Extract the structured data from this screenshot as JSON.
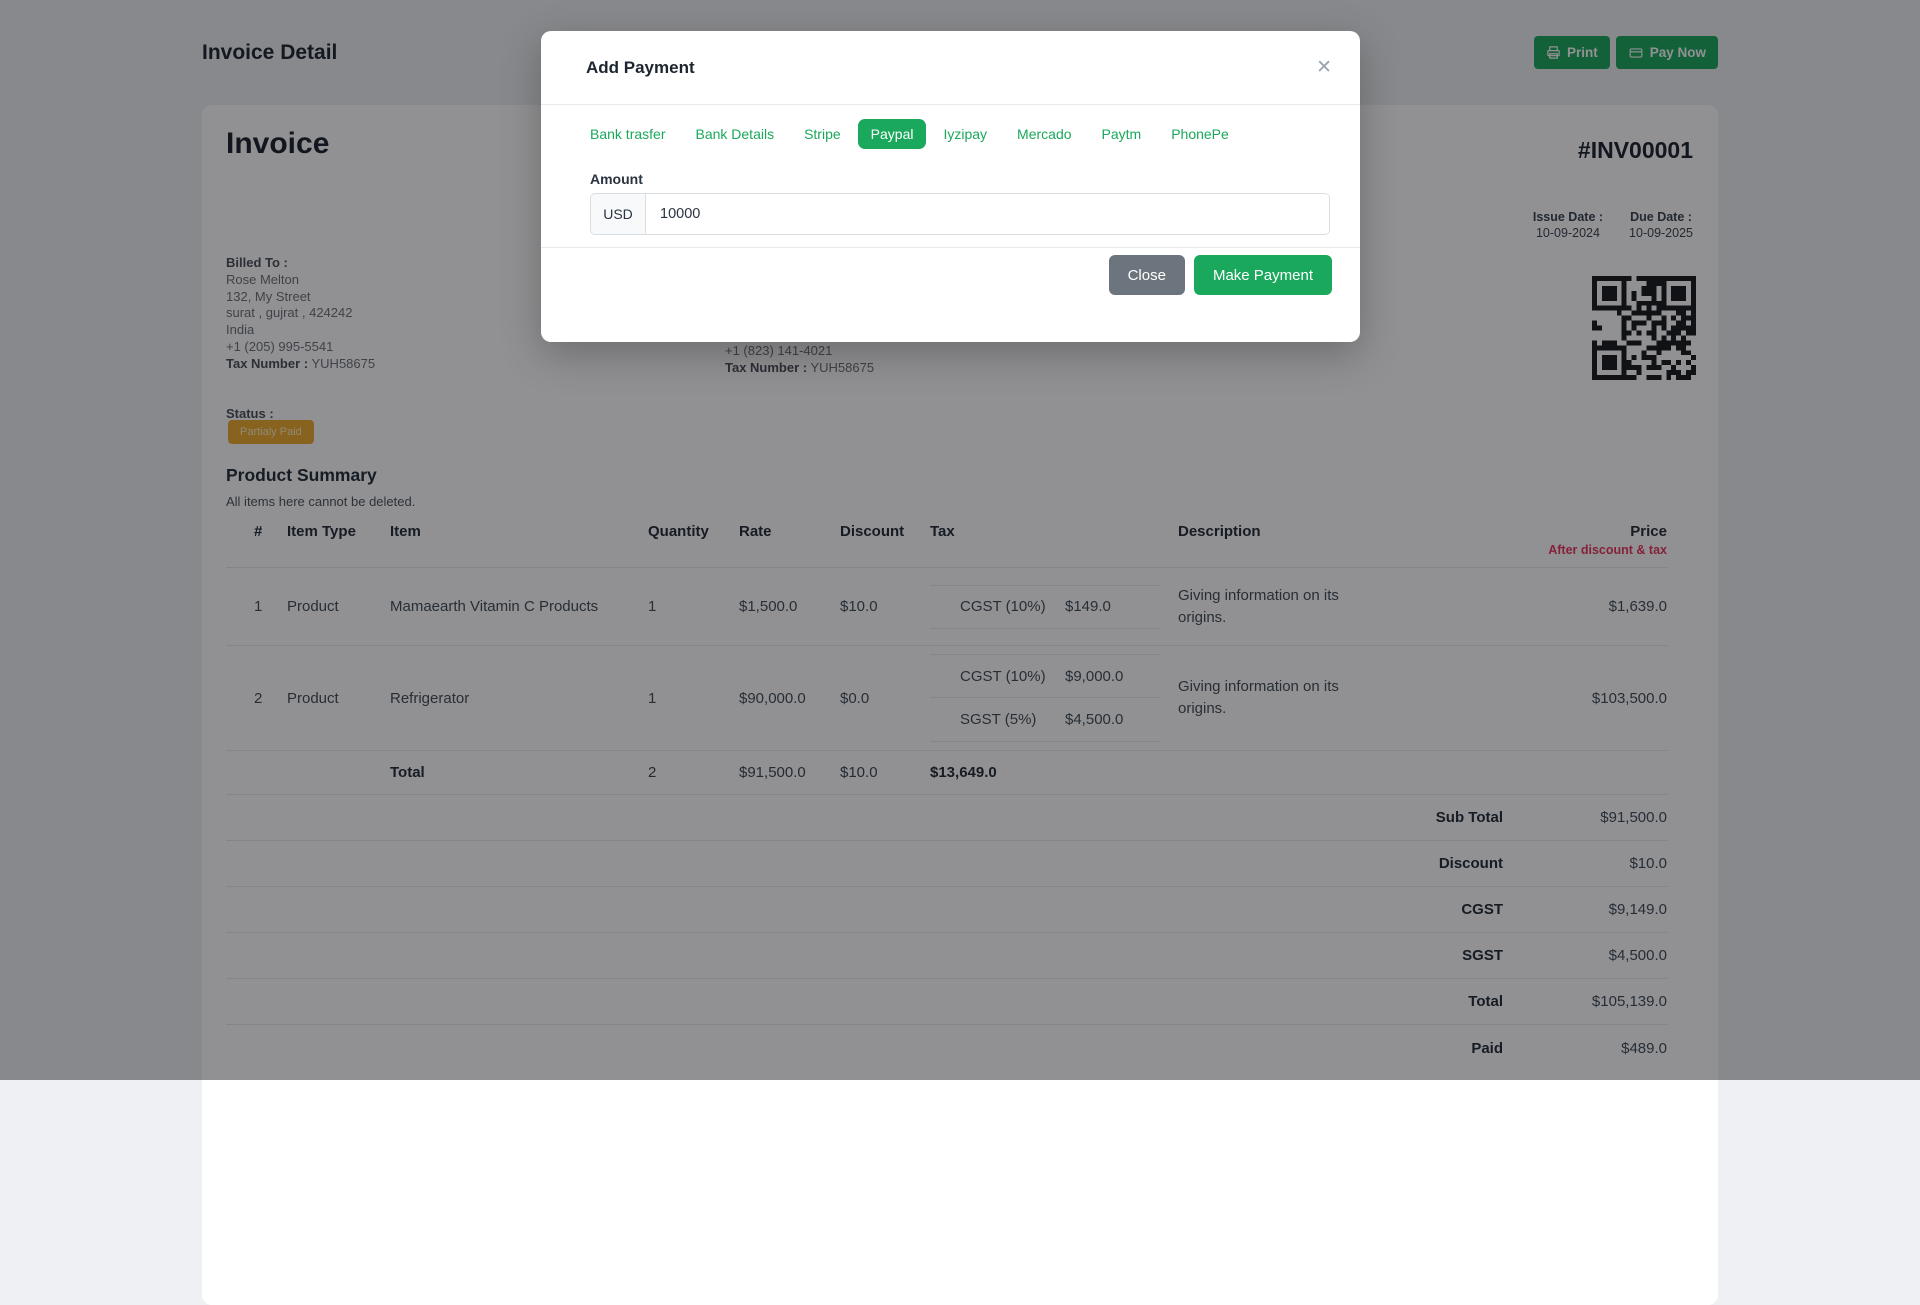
{
  "colors": {
    "accent_green": "#1aa85c",
    "badge_amber_bg": "#eeac2d",
    "badge_amber_text": "#fff0c9",
    "danger_red": "#e8355e",
    "secondary_gray": "#6c757d"
  },
  "header": {
    "title": "Invoice Detail",
    "print_button": "Print",
    "pay_now_button": "Pay Now"
  },
  "invoice": {
    "heading": "Invoice",
    "number": "#INV00001",
    "billed_to": {
      "label": "Billed To :",
      "name": "Rose Melton",
      "street": "132, My Street",
      "city_line": "surat , gujrat , 424242",
      "country": "India",
      "phone": "+1 (205) 995-5541",
      "tax_label": "Tax Number :",
      "tax_number": "YUH58675"
    },
    "shipping_visible": {
      "phone": "+1 (823) 141-4021",
      "tax_label": "Tax Number :",
      "tax_number": "YUH58675"
    },
    "issue_date_label": "Issue Date :",
    "issue_date": "10-09-2024",
    "due_date_label": "Due Date :",
    "due_date": "10-09-2025",
    "status_label": "Status :",
    "status": "Partialy Paid"
  },
  "products": {
    "title": "Product Summary",
    "note": "All items here cannot be deleted.",
    "headers": {
      "num": "#",
      "item_type": "Item Type",
      "item": "Item",
      "quantity": "Quantity",
      "rate": "Rate",
      "discount": "Discount",
      "tax": "Tax",
      "description": "Description",
      "price": "Price",
      "price_sub": "After discount & tax"
    },
    "rows": [
      {
        "num": "1",
        "item_type": "Product",
        "item": "Mamaearth Vitamin C Products",
        "quantity": "1",
        "rate": "$1,500.0",
        "discount": "$10.0",
        "taxes": [
          {
            "name": "CGST (10%)",
            "amount": "$149.0"
          }
        ],
        "description": "Giving information on its origins.",
        "price": "$1,639.0"
      },
      {
        "num": "2",
        "item_type": "Product",
        "item": "Refrigerator",
        "quantity": "1",
        "rate": "$90,000.0",
        "discount": "$0.0",
        "taxes": [
          {
            "name": "CGST (10%)",
            "amount": "$9,000.0"
          },
          {
            "name": "SGST (5%)",
            "amount": "$4,500.0"
          }
        ],
        "description": "Giving information on its origins.",
        "price": "$103,500.0"
      }
    ],
    "total_row": {
      "label": "Total",
      "quantity": "2",
      "rate": "$91,500.0",
      "discount": "$10.0",
      "tax": "$13,649.0"
    },
    "summary": [
      {
        "label": "Sub Total",
        "value": "$91,500.0"
      },
      {
        "label": "Discount",
        "value": "$10.0"
      },
      {
        "label": "CGST",
        "value": "$9,149.0"
      },
      {
        "label": "SGST",
        "value": "$4,500.0"
      },
      {
        "label": "Total",
        "value": "$105,139.0"
      },
      {
        "label": "Paid",
        "value": "$489.0"
      }
    ]
  },
  "modal": {
    "title": "Add Payment",
    "close_icon": "✕",
    "tabs": [
      "Bank trasfer",
      "Bank Details",
      "Stripe",
      "Paypal",
      "Iyzipay",
      "Mercado",
      "Paytm",
      "PhonePe"
    ],
    "active_tab": "Paypal",
    "amount_label": "Amount",
    "currency": "USD",
    "amount_value": "10000",
    "close_label": "Close",
    "submit_label": "Make Payment"
  }
}
